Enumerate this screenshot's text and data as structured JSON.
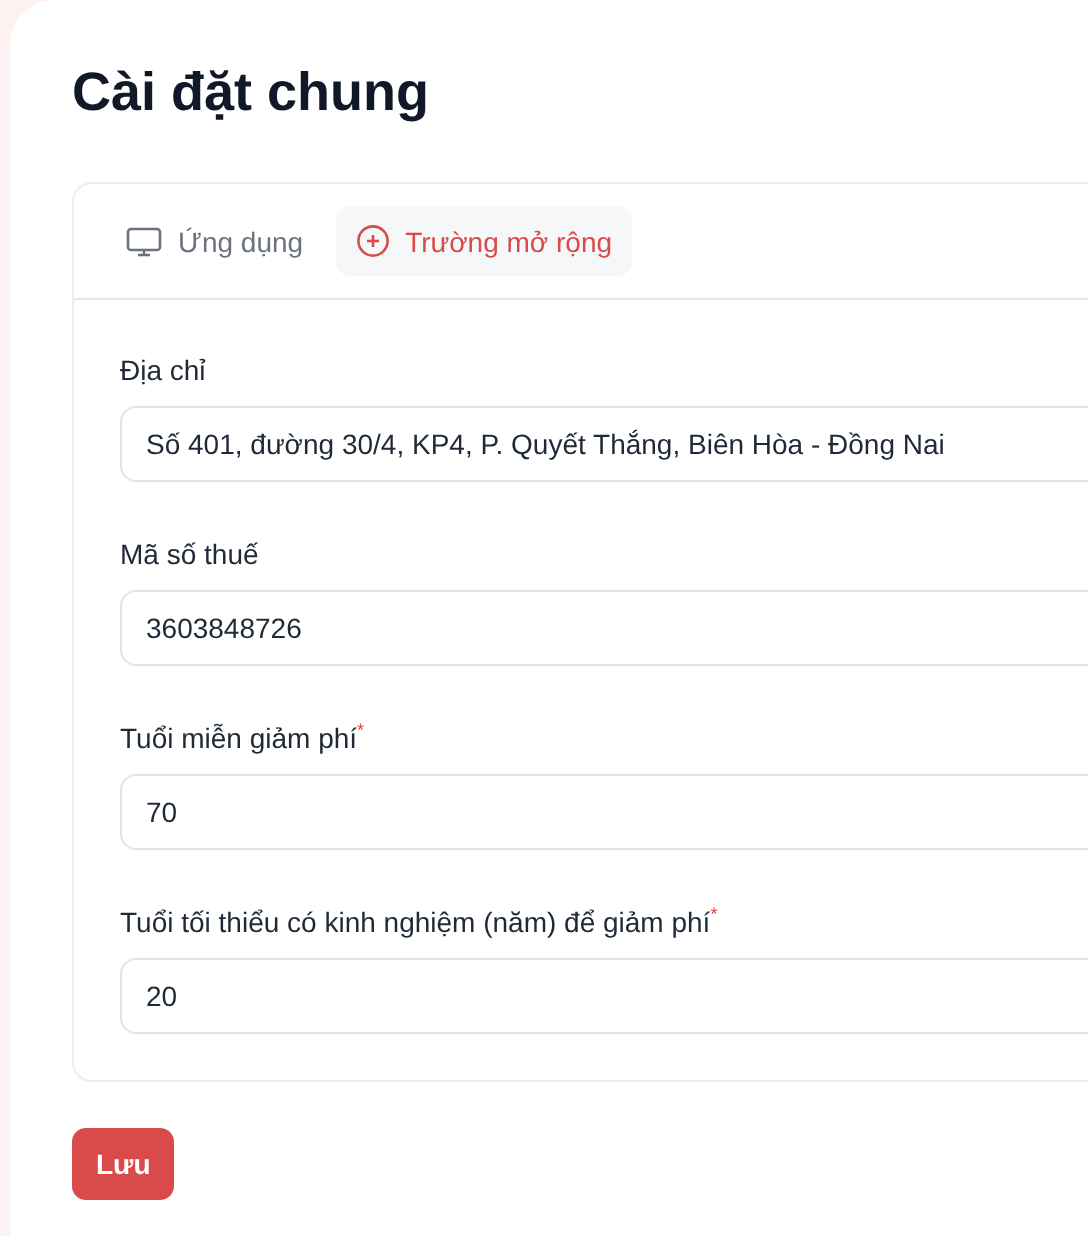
{
  "page": {
    "title": "Cài đặt chung"
  },
  "tabs": [
    {
      "label": "Ứng dụng",
      "kind": "monitor",
      "selected": false
    },
    {
      "label": "Trường mở rộng",
      "kind": "plus-circle",
      "selected": true
    }
  ],
  "fields": [
    {
      "label": "Địa chỉ",
      "value": "Số 401, đường 30/4, KP4, P. Quyết Thắng, Biên Hòa - Đồng Nai"
    },
    {
      "label": "Mã số thuế",
      "value": "3603848726"
    },
    {
      "label": "Tuổi miễn giảm phí",
      "required_mark": "*",
      "value": "70"
    },
    {
      "label": "Tuổi tối thiểu có kinh nghiệm (năm) để giảm phí",
      "required_mark": "*",
      "value": "20"
    }
  ],
  "save_button": "Lưu"
}
